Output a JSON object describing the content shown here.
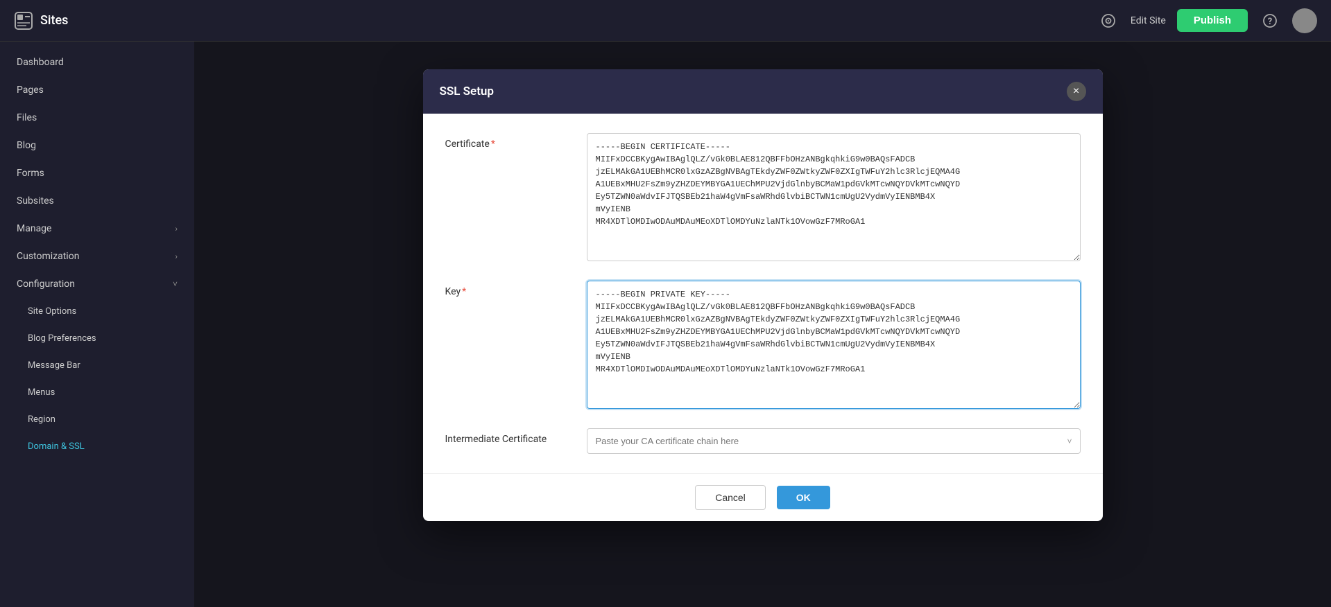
{
  "topbar": {
    "app_name": "Sites",
    "edit_site_label": "Edit Site",
    "publish_label": "Publish",
    "logo_icon": "◧"
  },
  "sidebar": {
    "items": [
      {
        "id": "dashboard",
        "label": "Dashboard",
        "indent": false,
        "has_chevron": false
      },
      {
        "id": "pages",
        "label": "Pages",
        "indent": false,
        "has_chevron": false
      },
      {
        "id": "files",
        "label": "Files",
        "indent": false,
        "has_chevron": false
      },
      {
        "id": "blog",
        "label": "Blog",
        "indent": false,
        "has_chevron": false
      },
      {
        "id": "forms",
        "label": "Forms",
        "indent": false,
        "has_chevron": false
      },
      {
        "id": "subsites",
        "label": "Subsites",
        "indent": false,
        "has_chevron": false
      },
      {
        "id": "manage",
        "label": "Manage",
        "indent": false,
        "has_chevron": true
      },
      {
        "id": "customization",
        "label": "Customization",
        "indent": false,
        "has_chevron": true
      },
      {
        "id": "configuration",
        "label": "Configuration",
        "indent": false,
        "has_chevron": true
      },
      {
        "id": "site-options",
        "label": "Site Options",
        "indent": true,
        "has_chevron": false
      },
      {
        "id": "blog-preferences",
        "label": "Blog Preferences",
        "indent": true,
        "has_chevron": false
      },
      {
        "id": "message-bar",
        "label": "Message Bar",
        "indent": true,
        "has_chevron": false
      },
      {
        "id": "menus",
        "label": "Menus",
        "indent": true,
        "has_chevron": false
      },
      {
        "id": "region",
        "label": "Region",
        "indent": true,
        "has_chevron": false
      },
      {
        "id": "domain-ssl",
        "label": "Domain & SSL",
        "indent": true,
        "has_chevron": false,
        "active": true
      }
    ]
  },
  "modal": {
    "title": "SSL Setup",
    "close_label": "×",
    "fields": {
      "certificate": {
        "label": "Certificate",
        "required": true,
        "value_line1": "-----BEGIN CERTIFICATE-----",
        "value_line2_plain": "MIIFxDCCBKygAwIBAglQLZ",
        "value_line2_rest": "/vGk0BLAE812QBFFbOHzANBgkqhkiG9w0BAQsFADCB",
        "value_line3": "jzELMAkGA1UEBhMCR0lxGzAZBgNVBAgTEkdyZWF0ZWtkyZWF0ZXIgTWFuY2hlc3RlcjEQMA4G",
        "value_line4": "A1UEBxMHU2FsZm9yZHZDEYMBYGA1UEChMPU2VjdGlnbyBCMaW1pdGVkMTcwNQYDVkMTcwNQYD",
        "value_line5": "Ey5TZWN0aWdvIFJTQSBEb21haW4gVmFsaWRhdGlvbiBCTWN1cmUgU2VydmVyIENBMB4X",
        "value_line6": "mVyIENB",
        "value_line7": "MR4XDTlOMDIwODAuMDAuMEoXDTlOMDYuNzlaNTk1OVowGzF7MRoGA1"
      },
      "key": {
        "label": "Key",
        "required": true,
        "value_line1": "-----BEGIN PRIVATE KEY-----",
        "value_line2_plain": "MIIFxDCCBKygAwIBAglQLZ",
        "value_line2_rest": "/vGk0BLAE812QBFFbOHzANBgkqhkiG9w0BAQsFADCB",
        "value_line3": "jzELMAkGA1UEBhMCR0lxGzAZBgNVBAgTEkdyZWF0ZWtkyZWF0ZXIgTWFuY2hlc3RlcjEQMA4G",
        "value_line4": "A1UEBxMHU2FsZm9yZHZDEYMBYGA1UEChMPU2VjdGlnbyBCMaW1pdGVkMTcwNQYDVkMTcwNQYD",
        "value_line5": "Ey5TZWN0aWdvIFJTQSBEb21haW4gVmFsaWRhdGlvbiBCTWN1cmUgU2VydmVyIENBMB4X",
        "value_line6": "mVyIENB",
        "value_line7": "MR4XDTlOMDIwODAuMDAuMEoXDTlOMDYuNzlaNTk1OVowGzF7MRoGA1"
      },
      "intermediate_certificate": {
        "label": "Intermediate Certificate",
        "required": false,
        "placeholder": "Paste your CA certificate chain here"
      }
    },
    "buttons": {
      "cancel_label": "Cancel",
      "ok_label": "OK"
    }
  }
}
